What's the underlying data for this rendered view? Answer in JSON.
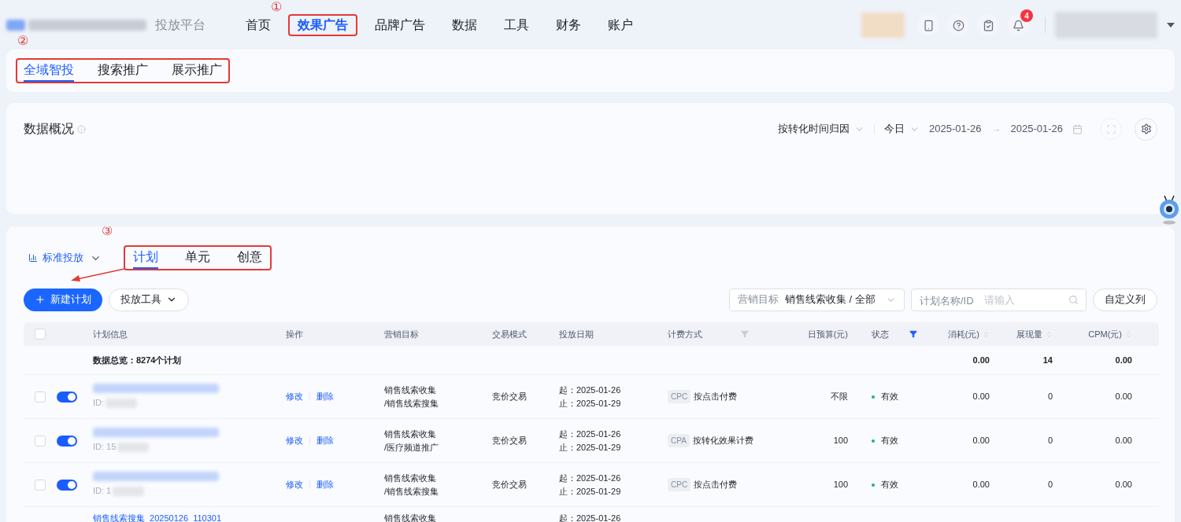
{
  "top_nav": {
    "platform_name": "投放平台",
    "annotation": "①",
    "items": [
      {
        "label": "首页",
        "selected": false
      },
      {
        "label": "效果广告",
        "selected": true
      },
      {
        "label": "品牌广告",
        "selected": false
      },
      {
        "label": "数据",
        "selected": false
      },
      {
        "label": "工具",
        "selected": false
      },
      {
        "label": "财务",
        "selected": false
      },
      {
        "label": "账户",
        "selected": false
      }
    ],
    "notification_count": "4"
  },
  "channel_tabs": {
    "annotation": "②",
    "items": [
      {
        "label": "全域智投",
        "selected": true
      },
      {
        "label": "搜索推广",
        "selected": false
      },
      {
        "label": "展示推广",
        "selected": false
      }
    ]
  },
  "overview": {
    "title": "数据概况",
    "attribution": "按转化时间归因",
    "range": "今日",
    "start_date": "2025-01-26",
    "date_separator": "→",
    "end_date": "2025-01-26"
  },
  "plans": {
    "mode": "标准投放",
    "annotation": "③",
    "tabs": [
      {
        "label": "计划",
        "selected": true
      },
      {
        "label": "单元",
        "selected": false
      },
      {
        "label": "创意",
        "selected": false
      }
    ],
    "new_button": "新建计划",
    "tools_button": "投放工具",
    "goal_filter": {
      "label": "营销目标",
      "value": "销售线索收集 / 全部"
    },
    "search": {
      "label": "计划名称/ID",
      "placeholder": "请输入"
    },
    "columns_button": "自定义列",
    "table": {
      "header_checked": false,
      "columns": [
        {
          "label": "计划信息"
        },
        {
          "label": "操作"
        },
        {
          "label": "营销目标"
        },
        {
          "label": "交易模式"
        },
        {
          "label": "投放日期"
        },
        {
          "label": "计费方式",
          "filter_active": false
        },
        {
          "label": "日预算(元)"
        },
        {
          "label": "状态",
          "filter_active": true
        },
        {
          "label": "消耗(元)",
          "sortable": true
        },
        {
          "label": "展现量",
          "sortable": true
        },
        {
          "label": "CPM(元)",
          "sortable": true
        }
      ],
      "summary": {
        "label": "数据总览：8274个计划",
        "cost": "0.00",
        "impressions": "14",
        "cpm": "0.00"
      },
      "rows": [
        {
          "checked": false,
          "enabled": true,
          "id_label": "ID:",
          "actions": [
            "修改",
            "删除"
          ],
          "goal": [
            "销售线索收集",
            "/销售线索搜集"
          ],
          "trade": "竞价交易",
          "start": "起：2025-01-26",
          "end": "止：2025-01-29",
          "billing_code": "CPC",
          "billing_label": "按点击付费",
          "budget": "不限",
          "status": "有效",
          "color": "#1db46e",
          "cost": "0.00",
          "impressions": "0",
          "cpm": "0.00"
        },
        {
          "checked": false,
          "enabled": true,
          "id_label": "ID: 15",
          "actions": [
            "修改",
            "删除"
          ],
          "goal": [
            "销售线索收集",
            "/医疗频道推广"
          ],
          "trade": "竞价交易",
          "start": "起：2025-01-26",
          "end": "止：2025-01-29",
          "billing_code": "CPA",
          "billing_label": "按转化效果计费",
          "budget": "100",
          "status": "有效",
          "color": "#1db46e",
          "cost": "0.00",
          "impressions": "0",
          "cpm": "0.00"
        },
        {
          "checked": false,
          "enabled": true,
          "id_label": "ID: 1",
          "actions": [
            "修改",
            "删除"
          ],
          "goal": [
            "销售线索收集",
            "/销售线索搜集"
          ],
          "trade": "竞价交易",
          "start": "起：2025-01-26",
          "end": "止：2025-01-29",
          "billing_code": "CPC",
          "billing_label": "按点击付费",
          "budget": "100",
          "status": "有效",
          "color": "#1db46e",
          "cost": "0.00",
          "impressions": "0",
          "cpm": "0.00"
        }
      ],
      "partial_row": {
        "name": "销售线索搜集_20250126_110301",
        "goal": "销售线索收集",
        "start": "起：2025-01-26"
      }
    }
  }
}
